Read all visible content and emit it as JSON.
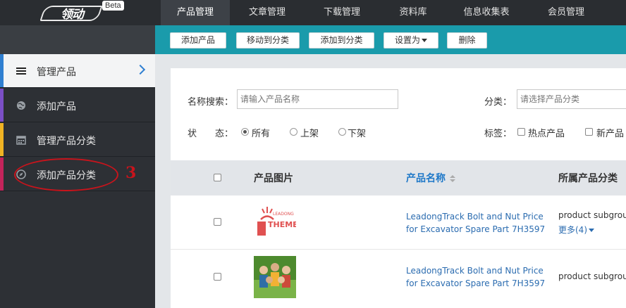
{
  "brand": {
    "logo_text": "领动",
    "beta": "Beta"
  },
  "top_nav": [
    "产品管理",
    "文章管理",
    "下载管理",
    "资料库",
    "信息收集表",
    "会员管理"
  ],
  "toolbar": {
    "add_product": "添加产品",
    "move_to_category": "移动到分类",
    "add_to_category": "添加到分类",
    "set_as": "设置为",
    "delete": "删除"
  },
  "sidebar": {
    "items": [
      {
        "label": "管理产品",
        "icon": "list-icon",
        "accent": "#2f7fd1"
      },
      {
        "label": "添加产品",
        "icon": "globe-icon",
        "accent": "#7b4fc6"
      },
      {
        "label": "管理产品分类",
        "icon": "calendar-icon",
        "accent": "#f0b323"
      },
      {
        "label": "添加产品分类",
        "icon": "compass-icon",
        "accent": "#c3245b"
      }
    ]
  },
  "annotation": {
    "number": "3",
    "color": "#c8141c"
  },
  "filters": {
    "name_label": "名称搜索：",
    "name_placeholder": "请输入产品名称",
    "category_label": "分类：",
    "category_placeholder": "请选择产品分类",
    "status_label": "状　　态：",
    "status_options": [
      "所有",
      "上架",
      "下架"
    ],
    "status_selected": "所有",
    "tags_label": "标签：",
    "tag_options": [
      "热点产品",
      "新产品"
    ]
  },
  "table": {
    "headers": {
      "image": "产品图片",
      "name": "产品名称",
      "category": "所属产品分类"
    },
    "rows": [
      {
        "name": "LeadongTrack Bolt and Nut Price for Excavator Spare Part 7H3597",
        "category": "product subgroup",
        "more": "更多(4)",
        "image": "leadong-theme-logo"
      },
      {
        "name": "LeadongTrack Bolt and Nut Price for Excavator Spare Part 7H3597",
        "category": "product subgroup",
        "image": "group-photo"
      }
    ]
  },
  "colors": {
    "topbar": "#2a2d31",
    "toolbar": "#1a9bab",
    "sidebar": "#2d3035",
    "link": "#2b6cb0"
  }
}
